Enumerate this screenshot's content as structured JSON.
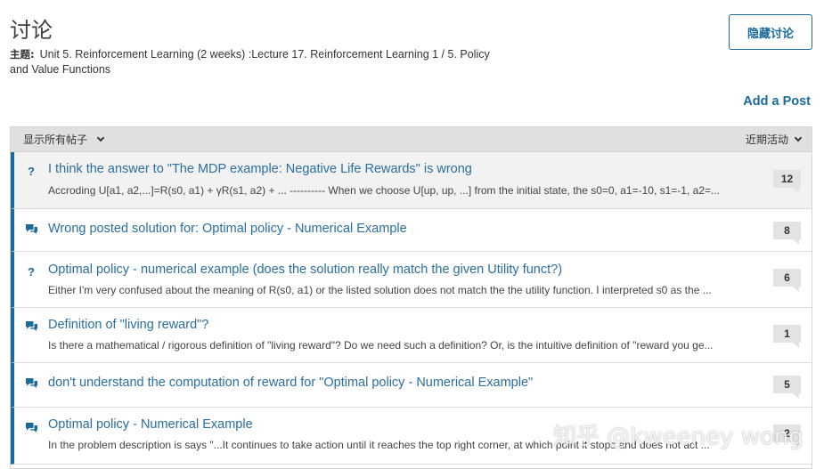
{
  "header": {
    "title": "讨论",
    "topic_label": "主题:",
    "topic_text": "Unit 5. Reinforcement Learning (2 weeks) :Lecture 17. Reinforcement Learning 1 / 5. Policy and Value Functions",
    "hide_button": "隐藏讨论",
    "add_post": "Add a Post"
  },
  "filter": {
    "show_all": "显示所有帖子",
    "sort": "近期活动"
  },
  "posts": [
    {
      "type": "question",
      "icon": "?",
      "title": "I think the answer to \"The MDP example: Negative Life Rewards\" is wrong",
      "preview": "Accroding U[a1, a2,...]=R(s0, a1) + γR(s1, a2) + ... ---------- When we choose U[up, up, ...] from the initial state, the s0=0, a1=-10, s1=-1, a2=...",
      "count": "12"
    },
    {
      "type": "discussion",
      "icon": "discussion-icon",
      "title": "Wrong posted solution for: Optimal policy - Numerical Example",
      "preview": "",
      "count": "8"
    },
    {
      "type": "question",
      "icon": "?",
      "title": "Optimal policy - numerical example (does the solution really match the given Utility funct?)",
      "preview": "Either I'm very confused about the meaning of R(s0, a1) or the listed solution does not match the the utility function. I interpreted s0 as the ...",
      "count": "6"
    },
    {
      "type": "discussion",
      "icon": "discussion-icon",
      "title": "Definition of \"living reward\"?",
      "preview": "Is there a mathematical / rigorous definition of \"living reward\"? Do we need such a definition? Or, is the intuitive definition of \"reward you ge...",
      "count": "1"
    },
    {
      "type": "discussion",
      "icon": "discussion-icon",
      "title": "don't understand the computation of reward for \"Optimal policy - Numerical Example\"",
      "preview": "",
      "count": "5"
    },
    {
      "type": "discussion",
      "icon": "discussion-icon",
      "title": "Optimal policy - Numerical Example",
      "preview": "In the problem description is says \"...It continues to take action until it reaches the top right corner, at which point it stops and does not act ...",
      "count": "2"
    }
  ],
  "watermark": "知乎 @kweeney wong",
  "colors": {
    "accent": "#1b6a9c",
    "link": "#2a6f9e",
    "header_bg": "#e0e0e0",
    "badge_bg": "#e3e3e3"
  }
}
